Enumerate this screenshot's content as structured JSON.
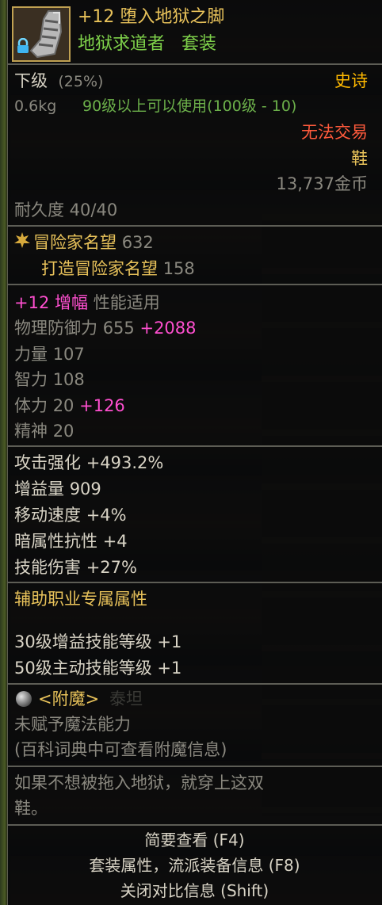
{
  "item": {
    "icon": "armored-boot-icon",
    "lock_icon": "lock-icon",
    "name": "+12 堕入地狱之脚",
    "set_name": "地狱求道者",
    "set_tag": "套装",
    "grade": "下级",
    "grade_pct": "(25%)",
    "rarity": "史诗",
    "weight": "0.6kg",
    "level_req": "90级以上可以使用(100级 - 10)",
    "trade": "无法交易",
    "slot": "鞋",
    "price": "13,737金币",
    "durability": "耐久度 40/40"
  },
  "fame": {
    "icon": "fame-emblem-icon",
    "label": "冒险家名望",
    "value": "632",
    "forge_label": "打造冒险家名望",
    "forge_value": "158"
  },
  "upgrade": {
    "level": "+12",
    "type": "增幅",
    "note": "性能适用"
  },
  "stats": [
    {
      "label": "物理防御力",
      "value": "655",
      "bonus": "+2088"
    },
    {
      "label": "力量",
      "value": "107",
      "bonus": ""
    },
    {
      "label": "智力",
      "value": "108",
      "bonus": ""
    },
    {
      "label": "体力",
      "value": "20",
      "bonus": "+126"
    },
    {
      "label": "精神",
      "value": "20",
      "bonus": ""
    }
  ],
  "effects": [
    {
      "label": "攻击强化",
      "value": "+493.2%"
    },
    {
      "label": "增益量",
      "value": "909"
    },
    {
      "label": "移动速度",
      "value": "+4%"
    },
    {
      "label": "暗属性抗性",
      "value": "+4"
    },
    {
      "label": "技能伤害",
      "value": "+27%"
    }
  ],
  "support": {
    "title": "辅助职业专属属性",
    "skills": [
      {
        "label": "30级增益技能等级",
        "value": "+1"
      },
      {
        "label": "50级主动技能等级",
        "value": "+1"
      }
    ]
  },
  "enchant": {
    "icon": "grey-orb-icon",
    "title": "<附魔>",
    "ghost": "泰坦",
    "none": "未赋予魔法能力",
    "hint": "(百科词典中可查看附魔信息)"
  },
  "flavor": {
    "line1": "如果不想被拖入地狱，就穿上这双",
    "line2": "鞋。"
  },
  "footer": {
    "brief": "简要查看 (F4)",
    "set_info": "套装属性，流派装备信息 (F8)",
    "close_compare": "关闭对比信息 (Shift)"
  },
  "colors": {
    "gold": "#e8c25a",
    "set_green": "#7ed14a",
    "rarity": "#ffb900",
    "bonus": "#ff4fd0",
    "trade": "#ff5a3c"
  }
}
